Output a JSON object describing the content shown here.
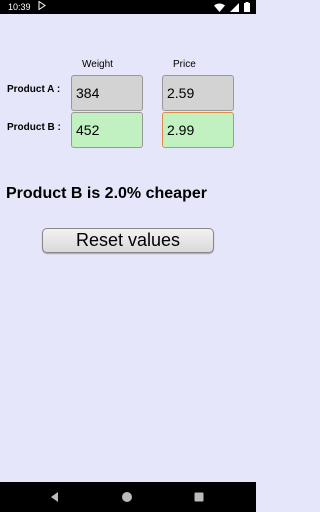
{
  "status_bar": {
    "time": "10:39",
    "left_icon": "play-store-icon",
    "right_icons": [
      "wifi-icon",
      "signal-icon",
      "battery-icon"
    ]
  },
  "form": {
    "weight_header": "Weight",
    "price_header": "Price",
    "product_a": {
      "label": "Product A :",
      "weight": "384",
      "price": "2.59"
    },
    "product_b": {
      "label": "Product B :",
      "weight": "452",
      "price": "2.99"
    }
  },
  "result_text": "Product B is 2.0% cheaper",
  "reset_button_label": "Reset values",
  "nav_bar": {
    "icons": [
      "back-icon",
      "home-icon",
      "recent-apps-icon"
    ]
  },
  "colors": {
    "background": "#e6e6fa",
    "field_gray": "#d3d3d3",
    "field_green": "#c1f0c1",
    "focus_border": "#e08a4a"
  }
}
